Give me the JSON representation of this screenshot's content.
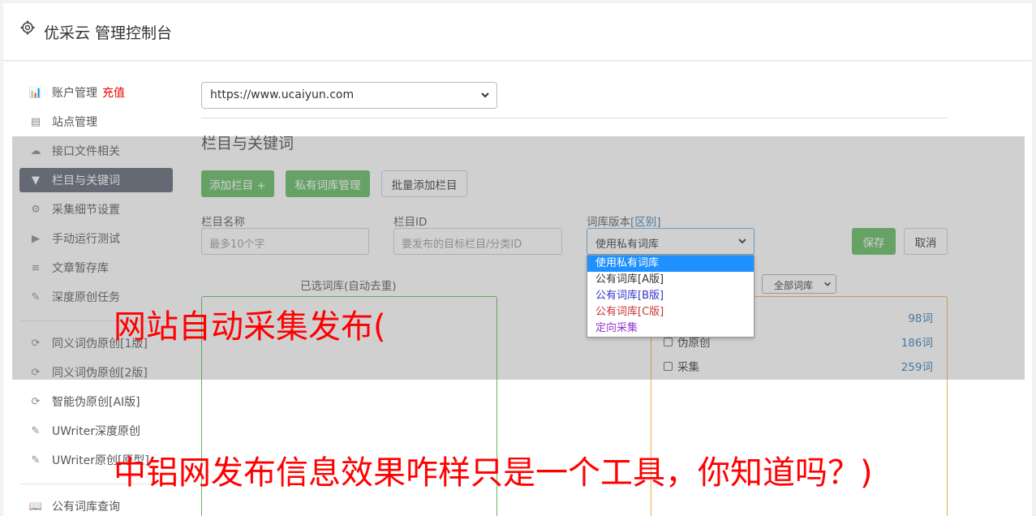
{
  "header": {
    "title": "优采云 管理控制台",
    "icon": "gear-icon"
  },
  "sidebar": {
    "items": [
      {
        "label": "账户管理",
        "badge": "充值",
        "icon": "bar-chart-icon",
        "glyph": "📊"
      },
      {
        "label": "站点管理",
        "icon": "server-icon",
        "glyph": "▤"
      },
      {
        "label": "接口文件相关",
        "icon": "cloud-upload-icon",
        "glyph": "☁"
      },
      {
        "label": "栏目与关键词",
        "icon": "filter-icon",
        "glyph": "▼",
        "active": true
      },
      {
        "label": "采集细节设置",
        "icon": "cogs-icon",
        "glyph": "⚙"
      },
      {
        "label": "手动运行测试",
        "icon": "play-circle-icon",
        "glyph": "▶"
      },
      {
        "label": "文章暂存库",
        "icon": "database-icon",
        "glyph": "≡"
      },
      {
        "label": "深度原创任务",
        "icon": "edit-icon",
        "glyph": "✎"
      },
      {
        "label": "同义词伪原创[1版]",
        "icon": "refresh-icon",
        "glyph": "⟳"
      },
      {
        "label": "同义词伪原创[2版]",
        "icon": "refresh-icon",
        "glyph": "⟳"
      },
      {
        "label": "智能伪原创[AI版]",
        "icon": "refresh-icon",
        "glyph": "⟳"
      },
      {
        "label": "UWriter深度原创",
        "icon": "edit-icon",
        "glyph": "✎"
      },
      {
        "label": "UWriter原创[原型]",
        "icon": "edit-icon",
        "glyph": "✎"
      },
      {
        "label": "公有词库查询",
        "icon": "book-icon",
        "glyph": "📖"
      }
    ]
  },
  "site_select": {
    "value": "https://www.ucaiyun.com"
  },
  "section": {
    "title": "栏目与关键词"
  },
  "buttons": {
    "add_column": "添加栏目 +",
    "private_lib": "私有词库管理",
    "batch_add": "批量添加栏目",
    "save": "保存",
    "cancel": "取消"
  },
  "form": {
    "name_label": "栏目名称",
    "name_placeholder": "最多10个字",
    "id_label": "栏目ID",
    "id_placeholder": "要发布的目标栏目/分类ID",
    "version_label": "词库版本",
    "version_hint": "[区别]",
    "version_value": "使用私有词库",
    "version_options": [
      "使用私有词库",
      "公有词库[A版]",
      "公有词库[B版]",
      "公有词库[C版]",
      "定向采集"
    ],
    "option_colors": [
      "#333333",
      "#333333",
      "#3333cc",
      "#cc3333",
      "#9933cc"
    ]
  },
  "selected": {
    "title": "已选词库(自动去重)"
  },
  "library": {
    "filter_value": "全部词库",
    "rows": [
      {
        "label": "",
        "count": "98词"
      },
      {
        "label": "伪原创",
        "count": "186词"
      },
      {
        "label": "采集",
        "count": "259词"
      }
    ]
  },
  "overlay": {
    "line1": "网站自动采集发布(",
    "line2": "中铝网发布信息效果咋样只是一个工具，你知道吗？)"
  }
}
